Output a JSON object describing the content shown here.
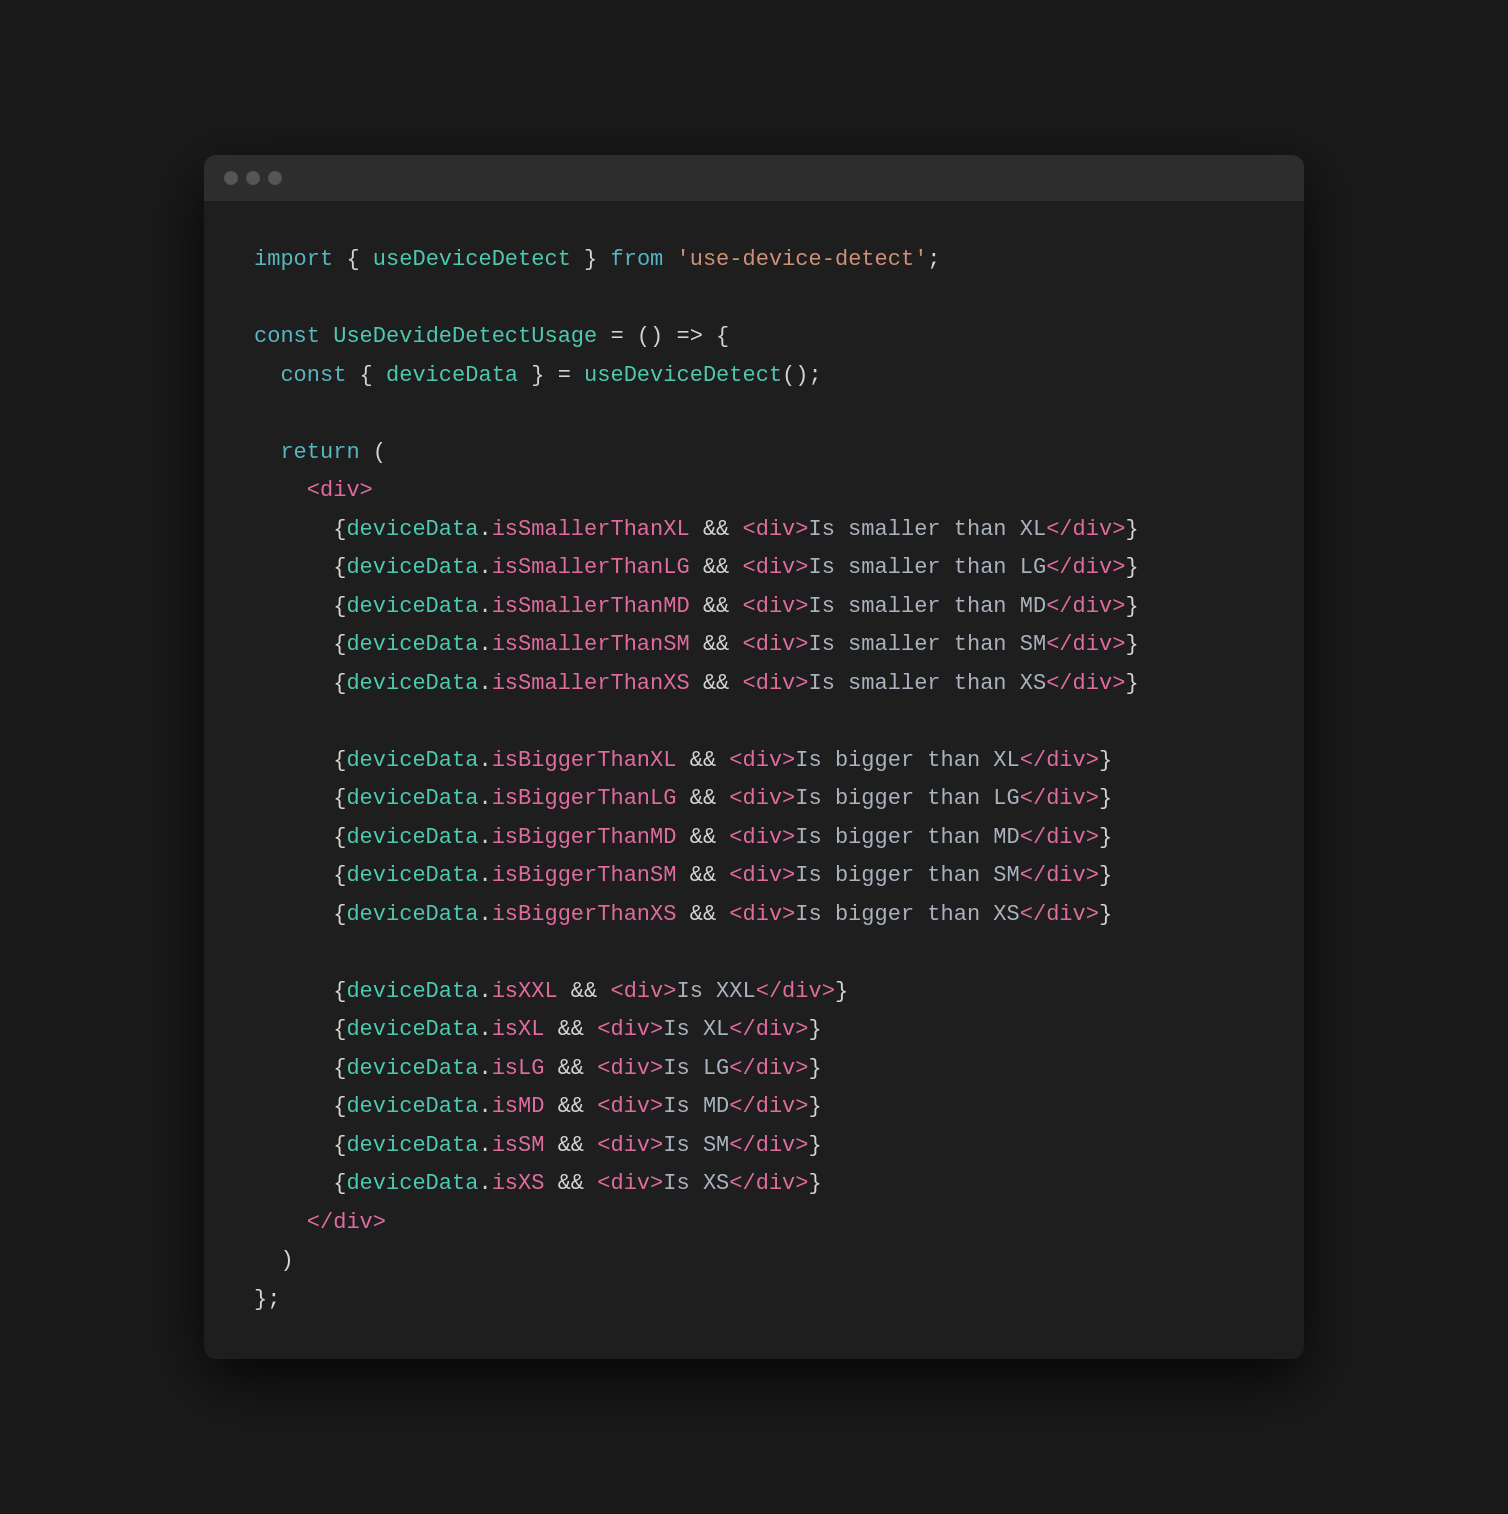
{
  "window": {
    "dots": [
      "red",
      "yellow",
      "green"
    ]
  },
  "code": {
    "lines": [
      {
        "id": "import-line",
        "parts": [
          {
            "text": "import",
            "class": "c-keyword"
          },
          {
            "text": " { ",
            "class": "c-white"
          },
          {
            "text": "useDeviceDetect",
            "class": "c-func"
          },
          {
            "text": " } ",
            "class": "c-white"
          },
          {
            "text": "from",
            "class": "c-keyword"
          },
          {
            "text": " ",
            "class": "c-white"
          },
          {
            "text": "'use-device-detect'",
            "class": "c-string"
          },
          {
            "text": ";",
            "class": "c-white"
          }
        ]
      },
      {
        "blank": true
      },
      {
        "id": "const-line",
        "parts": [
          {
            "text": "const",
            "class": "c-keyword"
          },
          {
            "text": " ",
            "class": "c-white"
          },
          {
            "text": "UseDevideDetectUsage",
            "class": "c-func"
          },
          {
            "text": " = () => {",
            "class": "c-white"
          }
        ]
      },
      {
        "id": "const-device-line",
        "indent": 1,
        "parts": [
          {
            "text": "const",
            "class": "c-keyword"
          },
          {
            "text": " { ",
            "class": "c-white"
          },
          {
            "text": "deviceData",
            "class": "c-var"
          },
          {
            "text": " } = ",
            "class": "c-white"
          },
          {
            "text": "useDeviceDetect",
            "class": "c-func"
          },
          {
            "text": "();",
            "class": "c-white"
          }
        ]
      },
      {
        "blank": true
      },
      {
        "id": "return-line",
        "indent": 1,
        "parts": [
          {
            "text": "return",
            "class": "c-keyword"
          },
          {
            "text": " (",
            "class": "c-white"
          }
        ]
      },
      {
        "id": "div-open-line",
        "indent": 2,
        "parts": [
          {
            "text": "<div>",
            "class": "c-pink"
          }
        ]
      },
      {
        "id": "smaller-xl-line",
        "indent": 3,
        "parts": [
          {
            "text": "{",
            "class": "c-white"
          },
          {
            "text": "deviceData",
            "class": "c-var"
          },
          {
            "text": ".",
            "class": "c-white"
          },
          {
            "text": "isSmallerThanXL",
            "class": "c-prop"
          },
          {
            "text": " && ",
            "class": "c-white"
          },
          {
            "text": "<div>",
            "class": "c-pink"
          },
          {
            "text": "Is smaller than XL",
            "class": "c-text"
          },
          {
            "text": "</div>",
            "class": "c-pink"
          },
          {
            "text": "}",
            "class": "c-white"
          }
        ]
      },
      {
        "id": "smaller-lg-line",
        "indent": 3,
        "parts": [
          {
            "text": "{",
            "class": "c-white"
          },
          {
            "text": "deviceData",
            "class": "c-var"
          },
          {
            "text": ".",
            "class": "c-white"
          },
          {
            "text": "isSmallerThanLG",
            "class": "c-prop"
          },
          {
            "text": " && ",
            "class": "c-white"
          },
          {
            "text": "<div>",
            "class": "c-pink"
          },
          {
            "text": "Is smaller than LG",
            "class": "c-text"
          },
          {
            "text": "</div>",
            "class": "c-pink"
          },
          {
            "text": "}",
            "class": "c-white"
          }
        ]
      },
      {
        "id": "smaller-md-line",
        "indent": 3,
        "parts": [
          {
            "text": "{",
            "class": "c-white"
          },
          {
            "text": "deviceData",
            "class": "c-var"
          },
          {
            "text": ".",
            "class": "c-white"
          },
          {
            "text": "isSmallerThanMD",
            "class": "c-prop"
          },
          {
            "text": " && ",
            "class": "c-white"
          },
          {
            "text": "<div>",
            "class": "c-pink"
          },
          {
            "text": "Is smaller than MD",
            "class": "c-text"
          },
          {
            "text": "</div>",
            "class": "c-pink"
          },
          {
            "text": "}",
            "class": "c-white"
          }
        ]
      },
      {
        "id": "smaller-sm-line",
        "indent": 3,
        "parts": [
          {
            "text": "{",
            "class": "c-white"
          },
          {
            "text": "deviceData",
            "class": "c-var"
          },
          {
            "text": ".",
            "class": "c-white"
          },
          {
            "text": "isSmallerThanSM",
            "class": "c-prop"
          },
          {
            "text": " && ",
            "class": "c-white"
          },
          {
            "text": "<div>",
            "class": "c-pink"
          },
          {
            "text": "Is smaller than SM",
            "class": "c-text"
          },
          {
            "text": "</div>",
            "class": "c-pink"
          },
          {
            "text": "}",
            "class": "c-white"
          }
        ]
      },
      {
        "id": "smaller-xs-line",
        "indent": 3,
        "parts": [
          {
            "text": "{",
            "class": "c-white"
          },
          {
            "text": "deviceData",
            "class": "c-var"
          },
          {
            "text": ".",
            "class": "c-white"
          },
          {
            "text": "isSmallerThanXS",
            "class": "c-prop"
          },
          {
            "text": " && ",
            "class": "c-white"
          },
          {
            "text": "<div>",
            "class": "c-pink"
          },
          {
            "text": "Is smaller than XS",
            "class": "c-text"
          },
          {
            "text": "</div>",
            "class": "c-pink"
          },
          {
            "text": "}",
            "class": "c-white"
          }
        ]
      },
      {
        "blank": true
      },
      {
        "id": "bigger-xl-line",
        "indent": 3,
        "parts": [
          {
            "text": "{",
            "class": "c-white"
          },
          {
            "text": "deviceData",
            "class": "c-var"
          },
          {
            "text": ".",
            "class": "c-white"
          },
          {
            "text": "isBiggerThanXL",
            "class": "c-prop"
          },
          {
            "text": " && ",
            "class": "c-white"
          },
          {
            "text": "<div>",
            "class": "c-pink"
          },
          {
            "text": "Is bigger than XL",
            "class": "c-text"
          },
          {
            "text": "</div>",
            "class": "c-pink"
          },
          {
            "text": "}",
            "class": "c-white"
          }
        ]
      },
      {
        "id": "bigger-lg-line",
        "indent": 3,
        "parts": [
          {
            "text": "{",
            "class": "c-white"
          },
          {
            "text": "deviceData",
            "class": "c-var"
          },
          {
            "text": ".",
            "class": "c-white"
          },
          {
            "text": "isBiggerThanLG",
            "class": "c-prop"
          },
          {
            "text": " && ",
            "class": "c-white"
          },
          {
            "text": "<div>",
            "class": "c-pink"
          },
          {
            "text": "Is bigger than LG",
            "class": "c-text"
          },
          {
            "text": "</div>",
            "class": "c-pink"
          },
          {
            "text": "}",
            "class": "c-white"
          }
        ]
      },
      {
        "id": "bigger-md-line",
        "indent": 3,
        "parts": [
          {
            "text": "{",
            "class": "c-white"
          },
          {
            "text": "deviceData",
            "class": "c-var"
          },
          {
            "text": ".",
            "class": "c-white"
          },
          {
            "text": "isBiggerThanMD",
            "class": "c-prop"
          },
          {
            "text": " && ",
            "class": "c-white"
          },
          {
            "text": "<div>",
            "class": "c-pink"
          },
          {
            "text": "Is bigger than MD",
            "class": "c-text"
          },
          {
            "text": "</div>",
            "class": "c-pink"
          },
          {
            "text": "}",
            "class": "c-white"
          }
        ]
      },
      {
        "id": "bigger-sm-line",
        "indent": 3,
        "parts": [
          {
            "text": "{",
            "class": "c-white"
          },
          {
            "text": "deviceData",
            "class": "c-var"
          },
          {
            "text": ".",
            "class": "c-white"
          },
          {
            "text": "isBiggerThanSM",
            "class": "c-prop"
          },
          {
            "text": " && ",
            "class": "c-white"
          },
          {
            "text": "<div>",
            "class": "c-pink"
          },
          {
            "text": "Is bigger than SM",
            "class": "c-text"
          },
          {
            "text": "</div>",
            "class": "c-pink"
          },
          {
            "text": "}",
            "class": "c-white"
          }
        ]
      },
      {
        "id": "bigger-xs-line",
        "indent": 3,
        "parts": [
          {
            "text": "{",
            "class": "c-white"
          },
          {
            "text": "deviceData",
            "class": "c-var"
          },
          {
            "text": ".",
            "class": "c-white"
          },
          {
            "text": "isBiggerThanXS",
            "class": "c-prop"
          },
          {
            "text": " && ",
            "class": "c-white"
          },
          {
            "text": "<div>",
            "class": "c-pink"
          },
          {
            "text": "Is bigger than XS",
            "class": "c-text"
          },
          {
            "text": "</div>",
            "class": "c-pink"
          },
          {
            "text": "}",
            "class": "c-white"
          }
        ]
      },
      {
        "blank": true
      },
      {
        "id": "is-xxl-line",
        "indent": 3,
        "parts": [
          {
            "text": "{",
            "class": "c-white"
          },
          {
            "text": "deviceData",
            "class": "c-var"
          },
          {
            "text": ".",
            "class": "c-white"
          },
          {
            "text": "isXXL",
            "class": "c-prop"
          },
          {
            "text": " && ",
            "class": "c-white"
          },
          {
            "text": "<div>",
            "class": "c-pink"
          },
          {
            "text": "Is XXL",
            "class": "c-text"
          },
          {
            "text": "</div>",
            "class": "c-pink"
          },
          {
            "text": "}",
            "class": "c-white"
          }
        ]
      },
      {
        "id": "is-xl-line",
        "indent": 3,
        "parts": [
          {
            "text": "{",
            "class": "c-white"
          },
          {
            "text": "deviceData",
            "class": "c-var"
          },
          {
            "text": ".",
            "class": "c-white"
          },
          {
            "text": "isXL",
            "class": "c-prop"
          },
          {
            "text": " && ",
            "class": "c-white"
          },
          {
            "text": "<div>",
            "class": "c-pink"
          },
          {
            "text": "Is XL",
            "class": "c-text"
          },
          {
            "text": "</div>",
            "class": "c-pink"
          },
          {
            "text": "}",
            "class": "c-white"
          }
        ]
      },
      {
        "id": "is-lg-line",
        "indent": 3,
        "parts": [
          {
            "text": "{",
            "class": "c-white"
          },
          {
            "text": "deviceData",
            "class": "c-var"
          },
          {
            "text": ".",
            "class": "c-white"
          },
          {
            "text": "isLG",
            "class": "c-prop"
          },
          {
            "text": " && ",
            "class": "c-white"
          },
          {
            "text": "<div>",
            "class": "c-pink"
          },
          {
            "text": "Is LG",
            "class": "c-text"
          },
          {
            "text": "</div>",
            "class": "c-pink"
          },
          {
            "text": "}",
            "class": "c-white"
          }
        ]
      },
      {
        "id": "is-md-line",
        "indent": 3,
        "parts": [
          {
            "text": "{",
            "class": "c-white"
          },
          {
            "text": "deviceData",
            "class": "c-var"
          },
          {
            "text": ".",
            "class": "c-white"
          },
          {
            "text": "isMD",
            "class": "c-prop"
          },
          {
            "text": " && ",
            "class": "c-white"
          },
          {
            "text": "<div>",
            "class": "c-pink"
          },
          {
            "text": "Is MD",
            "class": "c-text"
          },
          {
            "text": "</div>",
            "class": "c-pink"
          },
          {
            "text": "}",
            "class": "c-white"
          }
        ]
      },
      {
        "id": "is-sm-line",
        "indent": 3,
        "parts": [
          {
            "text": "{",
            "class": "c-white"
          },
          {
            "text": "deviceData",
            "class": "c-var"
          },
          {
            "text": ".",
            "class": "c-white"
          },
          {
            "text": "isSM",
            "class": "c-prop"
          },
          {
            "text": " && ",
            "class": "c-white"
          },
          {
            "text": "<div>",
            "class": "c-pink"
          },
          {
            "text": "Is SM",
            "class": "c-text"
          },
          {
            "text": "</div>",
            "class": "c-pink"
          },
          {
            "text": "}",
            "class": "c-white"
          }
        ]
      },
      {
        "id": "is-xs-line",
        "indent": 3,
        "parts": [
          {
            "text": "{",
            "class": "c-white"
          },
          {
            "text": "deviceData",
            "class": "c-var"
          },
          {
            "text": ".",
            "class": "c-white"
          },
          {
            "text": "isXS",
            "class": "c-prop"
          },
          {
            "text": " && ",
            "class": "c-white"
          },
          {
            "text": "<div>",
            "class": "c-pink"
          },
          {
            "text": "Is XS",
            "class": "c-text"
          },
          {
            "text": "</div>",
            "class": "c-pink"
          },
          {
            "text": "}",
            "class": "c-white"
          }
        ]
      },
      {
        "id": "div-close-line",
        "indent": 2,
        "parts": [
          {
            "text": "</div>",
            "class": "c-pink"
          }
        ]
      },
      {
        "id": "close-paren-line",
        "indent": 1,
        "parts": [
          {
            "text": ")",
            "class": "c-white"
          }
        ]
      },
      {
        "id": "close-brace-line",
        "parts": [
          {
            "text": "};",
            "class": "c-white"
          }
        ]
      }
    ]
  }
}
